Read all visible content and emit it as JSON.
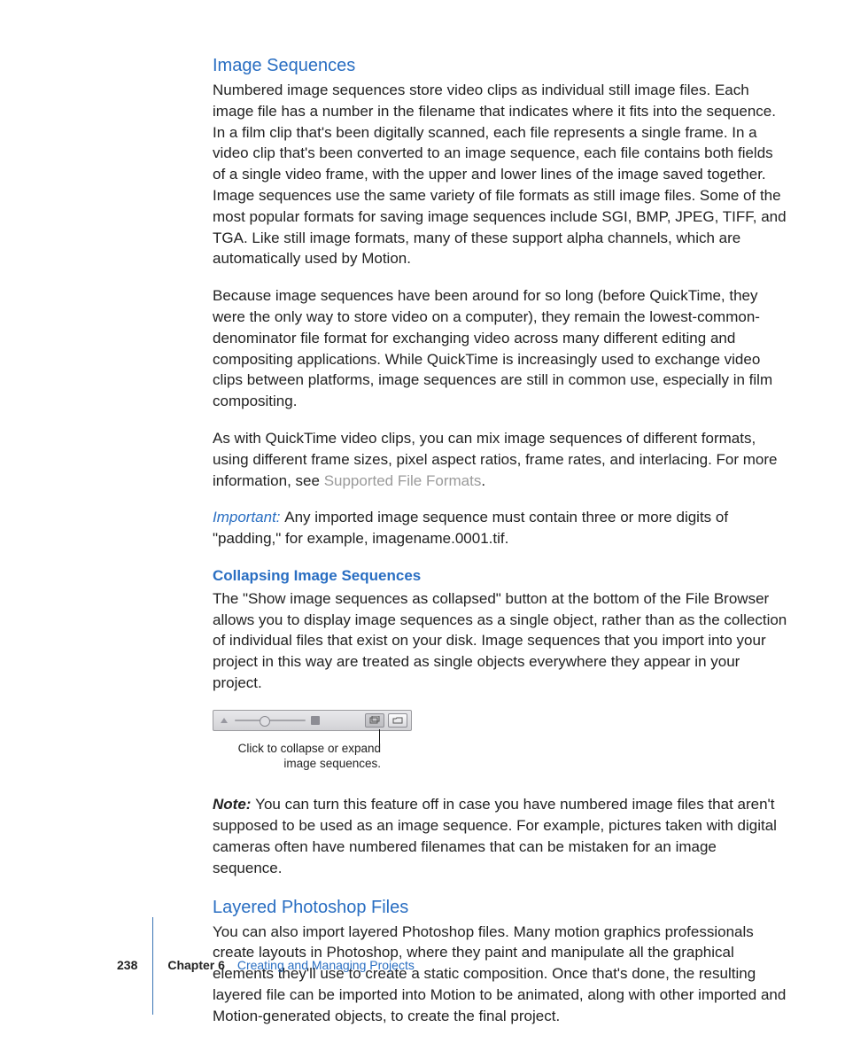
{
  "headings": {
    "imageSequences": "Image Sequences",
    "collapsing": "Collapsing Image Sequences",
    "layered": "Layered Photoshop Files"
  },
  "paragraphs": {
    "p1": "Numbered image sequences store video clips as individual still image files. Each image file has a number in the filename that indicates where it fits into the sequence. In a film clip that's been digitally scanned, each file represents a single frame. In a video clip that's been converted to an image sequence, each file contains both fields of a single video frame, with the upper and lower lines of the image saved together. Image sequences use the same variety of file formats as still image files. Some of the most popular formats for saving image sequences include SGI, BMP, JPEG, TIFF, and TGA. Like still image formats, many of these support alpha channels, which are automatically used by Motion.",
    "p2": "Because image sequences have been around for so long (before QuickTime, they were the only way to store video on a computer), they remain the lowest-common-denominator file format for exchanging video across many different editing and compositing applications. While QuickTime is increasingly used to exchange video clips between platforms, image sequences are still in common use, especially in film compositing.",
    "p3a": "As with QuickTime video clips, you can mix image sequences of different formats, using different frame sizes, pixel aspect ratios, frame rates, and interlacing. For more information, see ",
    "p3link": "Supported File Formats",
    "p3b": ".",
    "importantLabel": "Important:  ",
    "importantText": "Any imported image sequence must contain three or more digits of \"padding,\" for example, imagename.0001.tif.",
    "collapseText": "The \"Show image sequences as collapsed\" button at the bottom of the File Browser allows you to display image sequences as a single object, rather than as the collection of individual files that exist on your disk. Image sequences that you import into your project in this way are treated as single objects everywhere they appear in your project.",
    "callout": "Click to collapse or expand image sequences.",
    "noteLabel": "Note:  ",
    "noteText": "You can turn this feature off in case you have numbered image files that aren't supposed to be used as an image sequence. For example, pictures taken with digital cameras often have numbered filenames that can be mistaken for an image sequence.",
    "layeredText": "You can also import layered Photoshop files. Many motion graphics professionals create layouts in Photoshop, where they paint and manipulate all the graphical elements they'll use to create a static composition. Once that's done, the resulting layered file can be imported into Motion to be animated, along with other imported and Motion-generated objects, to create the final project."
  },
  "footer": {
    "pageNumber": "238",
    "chapterLabel": "Chapter 6",
    "chapterTitle": "Creating and Managing Projects"
  }
}
